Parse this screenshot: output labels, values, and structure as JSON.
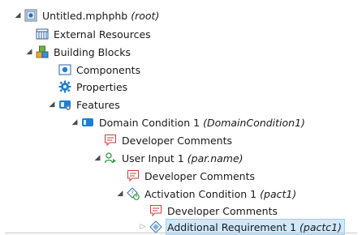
{
  "tree": {
    "root": {
      "name": "Untitled.mphphb",
      "tag": "(root)"
    },
    "external_resources": {
      "name": "External Resources"
    },
    "building_blocks": {
      "name": "Building Blocks"
    },
    "components": {
      "name": "Components"
    },
    "properties": {
      "name": "Properties"
    },
    "features": {
      "name": "Features"
    },
    "domain_condition": {
      "name": "Domain Condition 1",
      "tag": "(DomainCondition1)"
    },
    "dev_comments_1": {
      "name": "Developer Comments"
    },
    "user_input": {
      "name": "User Input 1",
      "tag": "(par.name)"
    },
    "dev_comments_2": {
      "name": "Developer Comments"
    },
    "activation_condition": {
      "name": "Activation Condition 1",
      "tag": "(pact1)"
    },
    "dev_comments_3": {
      "name": "Developer Comments"
    },
    "additional_requirement": {
      "name": "Additional Requirement 1",
      "tag": "(pactc1)"
    }
  },
  "colors": {
    "selection": "#cde8ff",
    "selection_border": "#99d1ff",
    "accent_blue": "#1b7fd4"
  }
}
